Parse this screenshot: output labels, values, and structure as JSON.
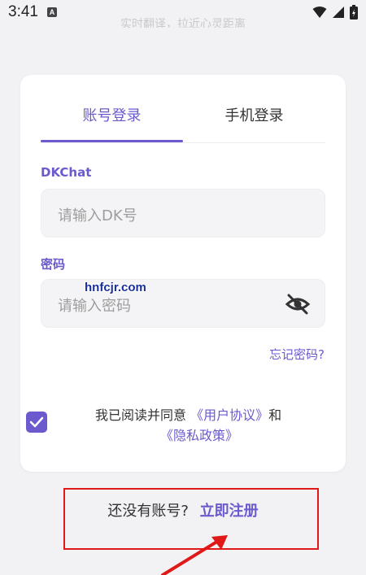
{
  "status_bar": {
    "time": "3:41",
    "app_icon_letter": "A"
  },
  "top_partial_text": "实时翻译，拉近心灵距离",
  "tabs": [
    {
      "label": "账号登录",
      "active": true
    },
    {
      "label": "手机登录",
      "active": false
    }
  ],
  "form": {
    "account_label": "DKChat",
    "account_placeholder": "请输入DK号",
    "password_label": "密码",
    "password_placeholder": "请输入密码",
    "forgot_password": "忘记密码?"
  },
  "agreement": {
    "checked": true,
    "prefix": "我已阅读并同意",
    "user_agreement": "《用户协议》",
    "connector": "和",
    "privacy_policy": "《隐私政策》"
  },
  "signup": {
    "prompt": "还没有账号?",
    "link": "立即注册"
  },
  "watermark": "hnfcjr.com",
  "colors": {
    "accent": "#6a5acd",
    "highlight": "#e01818"
  }
}
